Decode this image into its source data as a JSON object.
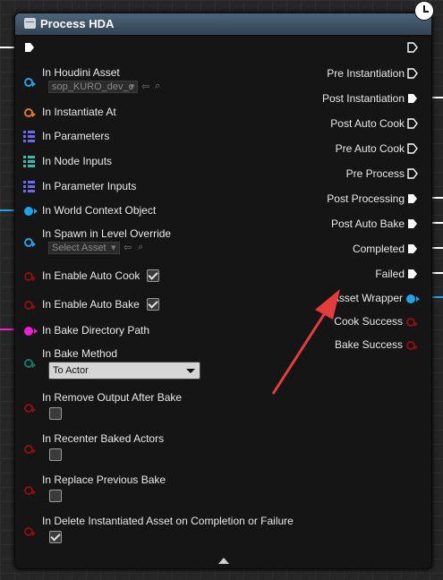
{
  "node": {
    "title": "Process HDA",
    "header_color": "#3f5468",
    "footer_icon": "collapse-up-icon"
  },
  "inputs": {
    "houdini_asset": {
      "label": "In Houdini Asset",
      "value": "sop_KURO_dev_c"
    },
    "instantiate_at": {
      "label": "In Instantiate At"
    },
    "parameters": {
      "label": "In Parameters"
    },
    "node_inputs": {
      "label": "In Node Inputs"
    },
    "parameter_inputs": {
      "label": "In Parameter Inputs"
    },
    "world_context": {
      "label": "In World Context Object"
    },
    "spawn_level": {
      "label": "In Spawn in Level Override",
      "value": "Select Asset"
    },
    "enable_auto_cook": {
      "label": "In Enable Auto Cook",
      "checked": true
    },
    "enable_auto_bake": {
      "label": "In Enable Auto Bake",
      "checked": true
    },
    "bake_dir": {
      "label": "In Bake Directory Path"
    },
    "bake_method": {
      "label": "In Bake Method",
      "value": "To Actor"
    },
    "remove_output": {
      "label": "In Remove Output After Bake",
      "checked": false
    },
    "recenter": {
      "label": "In Recenter Baked Actors",
      "checked": false
    },
    "replace_prev": {
      "label": "In Replace Previous Bake",
      "checked": false
    },
    "delete_inst": {
      "label": "In Delete Instantiated Asset on Completion or Failure",
      "checked": true
    }
  },
  "outputs": {
    "pre_instantiation": "Pre Instantiation",
    "post_instantiation": "Post Instantiation",
    "post_auto_cook": "Post Auto Cook",
    "pre_auto_cook": "Pre Auto Cook",
    "pre_process": "Pre Process",
    "post_processing": "Post Processing",
    "post_auto_bake": "Post Auto Bake",
    "completed": "Completed",
    "failed": "Failed",
    "asset_wrapper": "Asset Wrapper",
    "cook_success": "Cook Success",
    "bake_success": "Bake Success"
  },
  "colors": {
    "object_pin": "#1fa3e6",
    "struct_pin": "#e07a1c",
    "string_pin": "#f01fd0",
    "enum_pin": "#0f7a6a",
    "bool_pin": "#8a0f0f",
    "exec_pin": "#ffffff",
    "annotation_arrow": "#e23c3c"
  }
}
